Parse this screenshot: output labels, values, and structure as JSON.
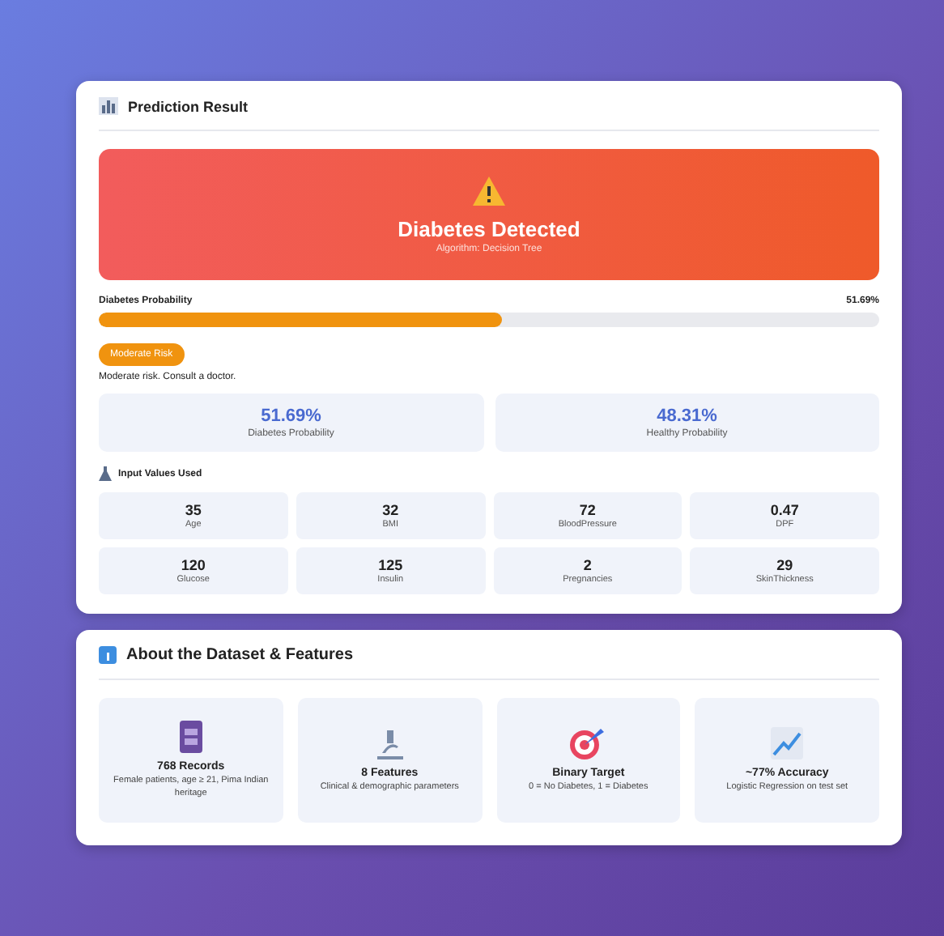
{
  "result": {
    "title": "Prediction Result",
    "banner": {
      "kind": "positive",
      "title": "Diabetes Detected",
      "subtitle": "Algorithm: Decision Tree"
    },
    "probability": {
      "label": "Diabetes Probability",
      "reading": "51.69%",
      "level": 0.5169
    },
    "risk": {
      "badge": "Moderate Risk",
      "note": "Moderate risk. Consult a doctor."
    },
    "stats": [
      {
        "value": "51.69%",
        "label": "Diabetes Probability"
      },
      {
        "value": "48.31%",
        "label": "Healthy Probability"
      }
    ],
    "inputs_title": "Input Values Used",
    "inputs": [
      {
        "value": "35",
        "label": "Age"
      },
      {
        "value": "32",
        "label": "BMI"
      },
      {
        "value": "72",
        "label": "BloodPressure"
      },
      {
        "value": "0.47",
        "label": "DPF"
      },
      {
        "value": "120",
        "label": "Glucose"
      },
      {
        "value": "125",
        "label": "Insulin"
      },
      {
        "value": "2",
        "label": "Pregnancies"
      },
      {
        "value": "29",
        "label": "SkinThickness"
      }
    ]
  },
  "about": {
    "title": "About the Dataset & Features",
    "features": [
      {
        "kind": "records",
        "title": "768 Records",
        "text": "Female patients, age ≥ 21, Pima Indian heritage"
      },
      {
        "kind": "features",
        "title": "8 Features",
        "text": "Clinical & demographic parameters"
      },
      {
        "kind": "target",
        "title": "Binary Target",
        "text": "0 = No Diabetes, 1 = Diabetes"
      },
      {
        "kind": "accuracy",
        "title": "~77% Accuracy",
        "text": "Logistic Regression on test set"
      }
    ]
  }
}
